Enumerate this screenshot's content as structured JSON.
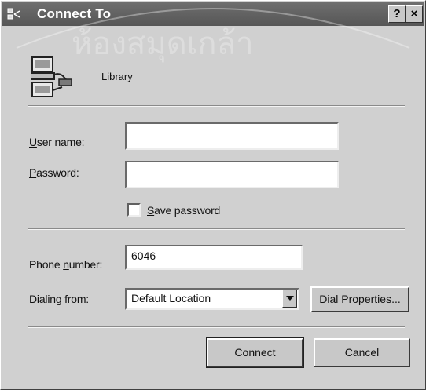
{
  "window": {
    "title": "Connect To",
    "help_glyph": "?",
    "close_glyph": "×",
    "watermark_text": "ห้องสมุดเกล้า"
  },
  "connection": {
    "name": "Library",
    "icon": "dialup-computer-icon"
  },
  "username": {
    "label_accel": "U",
    "label_rest": "ser name:",
    "value": ""
  },
  "password": {
    "label_accel": "P",
    "label_rest": "assword:",
    "value": ""
  },
  "save_password": {
    "label_accel": "S",
    "label_rest": "ave password",
    "checked": false
  },
  "phone": {
    "label_pre": "Phone ",
    "label_accel": "n",
    "label_rest": "umber:",
    "value": "6046"
  },
  "dialing_from": {
    "label_pre": "Dialing ",
    "label_accel": "f",
    "label_rest": "rom:",
    "value": "Default Location"
  },
  "buttons": {
    "dial_properties_accel": "D",
    "dial_properties_rest": "ial Properties...",
    "connect": "Connect",
    "cancel": "Cancel"
  }
}
